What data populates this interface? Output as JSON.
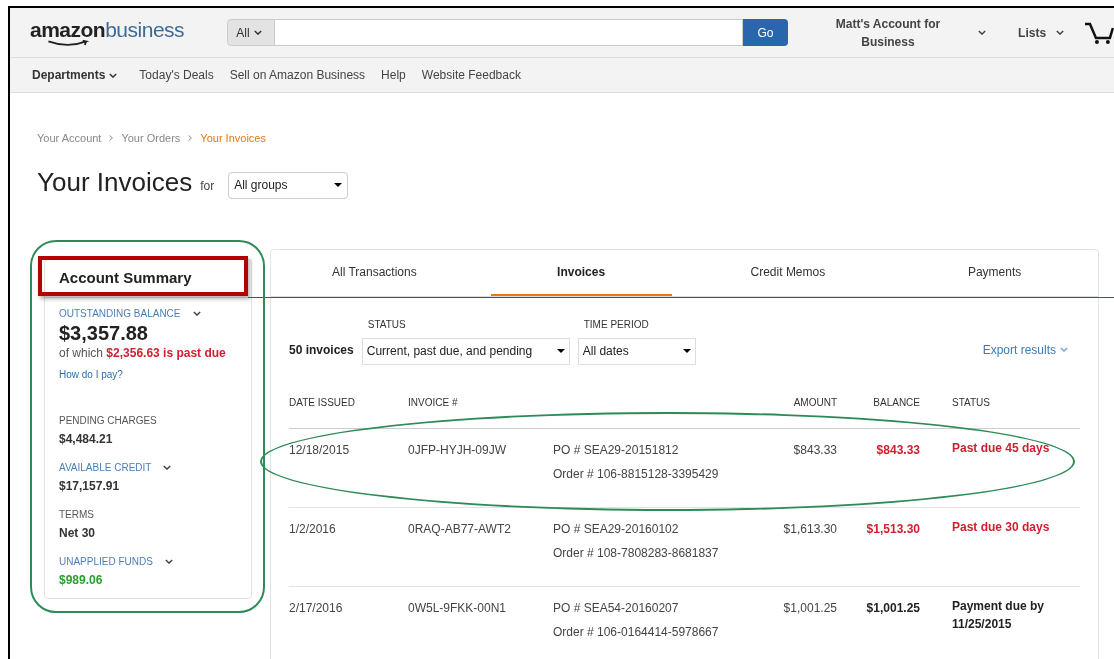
{
  "header": {
    "logo": {
      "bold": "amazon",
      "light": "business"
    },
    "search_category": "All",
    "search_button": "Go",
    "account": "Matt's Account for Business",
    "lists": "Lists"
  },
  "nav": {
    "departments": "Departments",
    "links": [
      "Today's Deals",
      "Sell on Amazon Business",
      "Help",
      "Website Feedback"
    ]
  },
  "breadcrumb": [
    {
      "label": "Your Account",
      "selected": false
    },
    {
      "label": "Your Orders",
      "selected": false
    },
    {
      "label": "Your Invoices",
      "selected": true
    }
  ],
  "title": "Your Invoices",
  "title_for": "for",
  "group_select": "All groups",
  "summary": {
    "title": "Account Summary",
    "items": [
      {
        "kind": "balance",
        "label": "OUTSTANDING BALANCE",
        "expandable": true,
        "value": "$3,357.88",
        "note": "of which **$2,356.63 is past due**",
        "link": "How do I pay?"
      },
      {
        "kind": "amount",
        "label": "PENDING CHARGES",
        "expandable": false,
        "value": "$4,484.21",
        "positive": false
      },
      {
        "kind": "amount",
        "label": "AVAILABLE CREDIT",
        "expandable": true,
        "value": "$17,157.91",
        "positive": false
      },
      {
        "kind": "amount",
        "label": "TERMS",
        "expandable": false,
        "value": "Net 30",
        "positive": false
      },
      {
        "kind": "amount",
        "label": "UNAPPLIED FUNDS",
        "expandable": true,
        "value": "$989.06",
        "positive": true
      }
    ]
  },
  "tabs": [
    {
      "label": "All Transactions",
      "selected": false
    },
    {
      "label": "Invoices",
      "selected": true
    },
    {
      "label": "Credit Memos",
      "selected": false
    },
    {
      "label": "Payments",
      "selected": false
    }
  ],
  "filters": {
    "count": "50 invoices",
    "status_label": "STATUS",
    "status_value": "Current, past due, and pending",
    "period_label": "TIME PERIOD",
    "period_value": "All dates",
    "export": "Export results"
  },
  "table": {
    "columns": [
      "DATE ISSUED",
      "INVOICE #",
      "AMOUNT",
      "BALANCE",
      "STATUS"
    ],
    "rows": [
      {
        "date": "12/18/2015",
        "invoice": "0JFP-HYJH-09JW",
        "po": "PO # SEA29-20151812",
        "order": "Order # 106-8815128-3395429",
        "amount": "$843.33",
        "balance": "$843.33",
        "status": "Past due 45 days",
        "overdue": true
      },
      {
        "date": "1/2/2016",
        "invoice": "0RAQ-AB77-AWT2",
        "po": "PO # SEA29-20160102",
        "order": "Order # 108-7808283-8681837",
        "amount": "$1,613.30",
        "balance": "$1,513.30",
        "status": "Past due 30 days",
        "overdue": true
      },
      {
        "date": "2/17/2016",
        "invoice": "0W5L-9FKK-00N1",
        "po": "PO # SEA54-20160207",
        "order": "Order # 106-0164414-5978667",
        "amount": "$1,001.25",
        "balance": "$1,001.25",
        "status": "Payment due by 11/25/2015",
        "overdue": false
      }
    ]
  }
}
